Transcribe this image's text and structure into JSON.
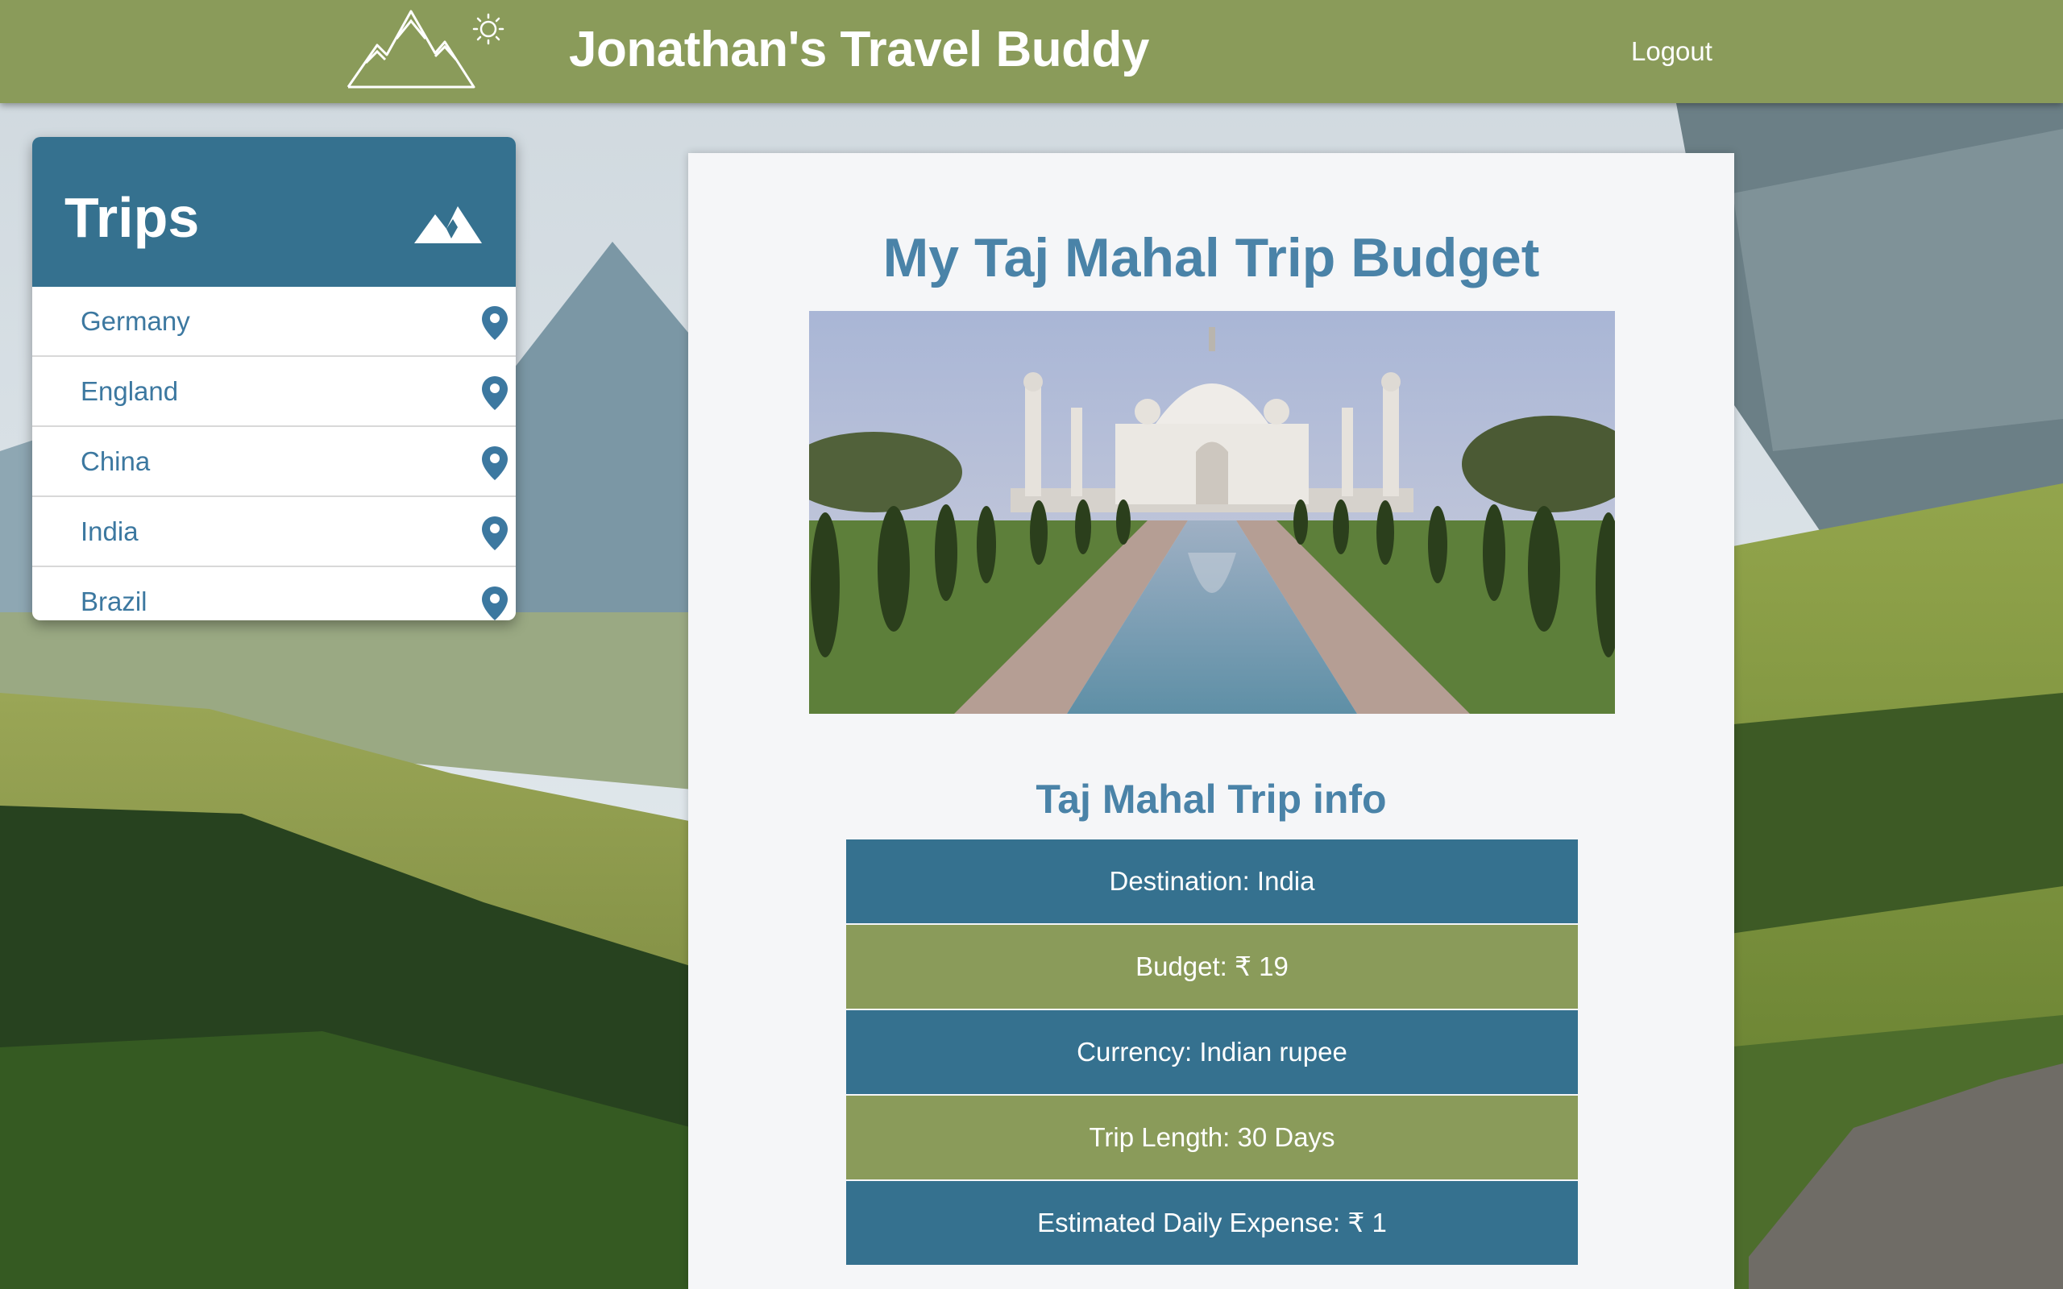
{
  "header": {
    "title": "Jonathan's Travel Buddy",
    "logout_label": "Logout",
    "logo_icon": "mountain-sun-logo-icon"
  },
  "sidebar": {
    "title": "Trips",
    "title_icon": "mountain-icon",
    "items": [
      {
        "label": "Germany",
        "icon": "map-pin-icon"
      },
      {
        "label": "England",
        "icon": "map-pin-icon"
      },
      {
        "label": "China",
        "icon": "map-pin-icon"
      },
      {
        "label": "India",
        "icon": "map-pin-icon"
      },
      {
        "label": "Brazil",
        "icon": "map-pin-icon"
      }
    ]
  },
  "main": {
    "title": "My Taj Mahal Trip Budget",
    "info_title": "Taj Mahal Trip info",
    "info_rows": [
      {
        "text": "Destination: India"
      },
      {
        "text": "Budget: ₹ 19"
      },
      {
        "text": "Currency: Indian rupee"
      },
      {
        "text": "Trip Length: 30 Days"
      },
      {
        "text": "Estimated Daily Expense: ₹ 1"
      }
    ]
  },
  "colors": {
    "header_green": "#8a9b5a",
    "sidebar_blue": "#35718f",
    "title_blue": "#4a83a8",
    "card_bg": "#f5f6f8"
  }
}
